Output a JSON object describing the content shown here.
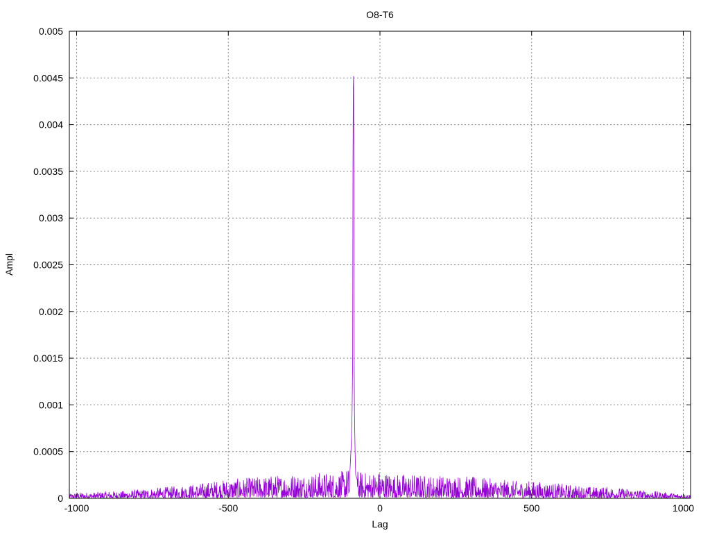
{
  "chart_data": {
    "type": "line",
    "title": "O8-T6",
    "xlabel": "Lag",
    "ylabel": "Ampl",
    "xlim": [
      -1024,
      1024
    ],
    "ylim": [
      0,
      0.005
    ],
    "xticks": [
      "-1000",
      "-500",
      "0",
      "500",
      "1000"
    ],
    "yticks": [
      "0",
      "0.0005",
      "0.001",
      "0.0015",
      "0.002",
      "0.0025",
      "0.003",
      "0.0035",
      "0.004",
      "0.0045",
      "0.005"
    ],
    "grid": true,
    "legend": "none",
    "series_color": "#9400d3",
    "peak": {
      "lag": -87,
      "value": 0.00452
    },
    "series": [
      {
        "x": [
          -1024,
          -1000,
          -950,
          -900,
          -850,
          -800,
          -750,
          -700,
          -650,
          -600,
          -550,
          -500,
          -450,
          -400,
          -350,
          -300,
          -250,
          -200,
          -150,
          -120,
          -100,
          -95,
          -92,
          -90,
          -89,
          -88,
          -87,
          -86,
          -85,
          -84,
          -82,
          -80,
          -75,
          -70,
          -50,
          0,
          50,
          100,
          150,
          200,
          250,
          300,
          350,
          400,
          450,
          500,
          550,
          600,
          650,
          700,
          750,
          800,
          850,
          900,
          950,
          1000,
          1024
        ],
        "y": [
          3e-05,
          4e-05,
          4e-05,
          5e-05,
          5e-05,
          6e-05,
          7e-05,
          8e-05,
          9e-05,
          0.0001,
          0.00012,
          0.00013,
          0.00014,
          0.00015,
          0.00016,
          0.00017,
          0.00017,
          0.00018,
          0.00018,
          0.00019,
          0.00022,
          0.00055,
          0.0009,
          0.0015,
          0.0035,
          0.0044,
          0.00452,
          0.0035,
          0.0015,
          0.0009,
          0.0005,
          0.00025,
          0.0002,
          0.00019,
          0.00018,
          0.00019,
          0.00017,
          0.00017,
          0.00016,
          0.00016,
          0.00016,
          0.00015,
          0.00014,
          0.00013,
          0.00012,
          0.00012,
          0.00011,
          0.0001,
          9e-05,
          8e-05,
          8e-05,
          7e-05,
          6e-05,
          5e-05,
          4e-05,
          3e-05,
          3e-05
        ]
      }
    ]
  }
}
